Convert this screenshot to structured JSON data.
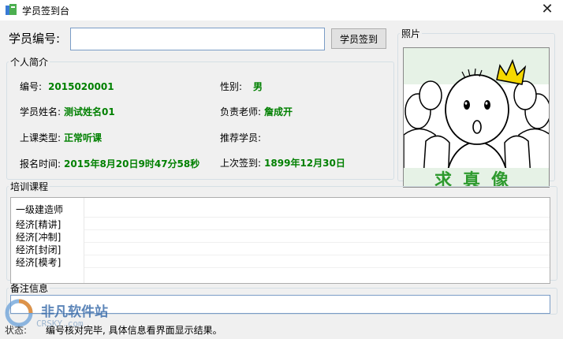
{
  "window": {
    "title": "学员签到台"
  },
  "header": {
    "id_label": "学员编号:",
    "id_value": "",
    "checkin_label": "学员签到"
  },
  "profile": {
    "legend": "个人简介",
    "number_label": "编号:",
    "number_value": "2015020001",
    "gender_label": "性别:",
    "gender_value": "男",
    "name_label": "学员姓名:",
    "name_value": "测试姓名01",
    "teacher_label": "负责老师:",
    "teacher_value": "詹成开",
    "class_type_label": "上课类型:",
    "class_type_value": "正常听课",
    "referrer_label": "推荐学员:",
    "referrer_value": "",
    "enroll_label": "报名时间:",
    "enroll_value": "2015年8月20日9时47分58秒",
    "last_checkin_label": "上次签到:",
    "last_checkin_value": "1899年12月30日"
  },
  "photo": {
    "legend": "照片",
    "banner": "求真像"
  },
  "courses": {
    "legend": "培训课程",
    "items": [
      "一级建造师",
      "经济[精讲]",
      "经济[冲制]",
      "经济[封闭]",
      "经济[模考]"
    ]
  },
  "notes": {
    "legend": "备注信息",
    "value": ""
  },
  "status": {
    "label": "状态:",
    "text": "编号核对完毕, 具体信息看界面显示结果。"
  },
  "watermark": {
    "text": "非凡软件站",
    "sub": "CRSKY.com"
  },
  "colors": {
    "value_green": "#008000",
    "input_border": "#7a9cc6",
    "crown": "#f5d800"
  }
}
